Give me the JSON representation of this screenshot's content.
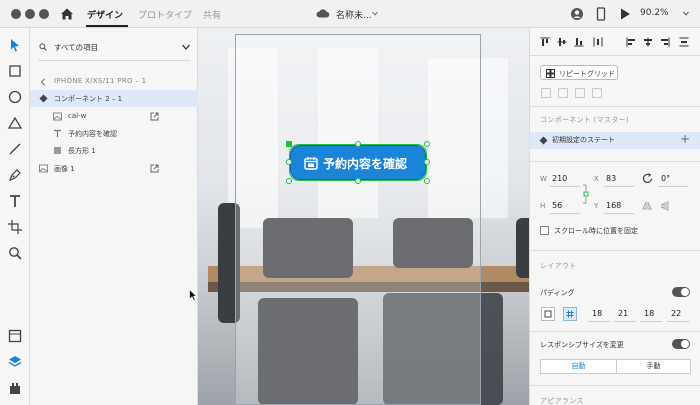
{
  "titlebar": {
    "tabs": [
      {
        "label": "デザイン"
      },
      {
        "label": "プロトタイプ"
      },
      {
        "label": "共有"
      }
    ],
    "document_title": "名称未...",
    "zoom": "90.2%"
  },
  "layers": {
    "search_label": "すべての項目",
    "breadcrumb": "IPHONE X/XS/11 PRO – 1",
    "items": [
      {
        "label": "コンポーネント 2 – 1"
      },
      {
        "label": "cal-w"
      },
      {
        "label": "予約内容を確認"
      },
      {
        "label": "長方形 1"
      },
      {
        "label": "画像 1"
      }
    ]
  },
  "canvas": {
    "button_label": "予約内容を確認",
    "button_icon": "calendar-icon"
  },
  "props": {
    "repeat_grid_label": "リピートグリッド",
    "component_section": "コンポーネント (マスター)",
    "state_label": "初期設定のステート",
    "add_state": "+",
    "w_label": "W",
    "w_value": "210",
    "x_label": "X",
    "x_value": "83",
    "rotation_value": "0°",
    "h_label": "H",
    "h_value": "56",
    "y_label": "Y",
    "y_value": "168",
    "fix_scroll_label": "スクロール時に位置を固定",
    "layout_section": "レイアウト",
    "padding_label": "パディング",
    "padding_values": [
      "18",
      "21",
      "18",
      "22"
    ],
    "responsive_label": "レスポンシブサイズを変更",
    "resize_options": {
      "auto": "自動",
      "manual": "手動"
    },
    "appearance_section": "アピアランス"
  },
  "colors": {
    "accent_button": "#1a84d8",
    "selection": "#1fbf3f",
    "selected_row": "#dde9f6",
    "active_auto": "#1a84d8"
  }
}
